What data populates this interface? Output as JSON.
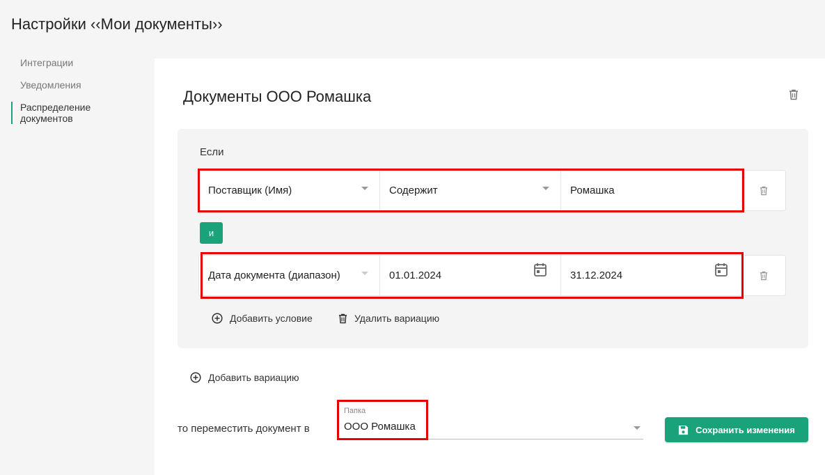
{
  "page": {
    "title": "Настройки ‹‹Мои документы››"
  },
  "sidebar": {
    "items": [
      {
        "label": "Интеграции"
      },
      {
        "label": "Уведомления"
      },
      {
        "label": "Распределение документов"
      }
    ]
  },
  "rule": {
    "title": "Документы ООО Ромашка",
    "if_label": "Если",
    "conditions": [
      {
        "field": "Поставщик (Имя)",
        "operator": "Содержит",
        "value": "Ромашка"
      },
      {
        "field": "Дата документа (диапазон)",
        "date_from": "01.01.2024",
        "date_to": "31.12.2024"
      }
    ],
    "and_label": "и",
    "add_condition_label": "Добавить условие",
    "delete_variation_label": "Удалить вариацию",
    "add_variation_label": "Добавить вариацию",
    "move_label": "то переместить документ в",
    "folder_label": "Папка",
    "folder_value": "ООО Ромашка",
    "save_label": "Сохранить изменения"
  },
  "colors": {
    "accent": "#1aa37a",
    "highlight": "#e60000"
  }
}
